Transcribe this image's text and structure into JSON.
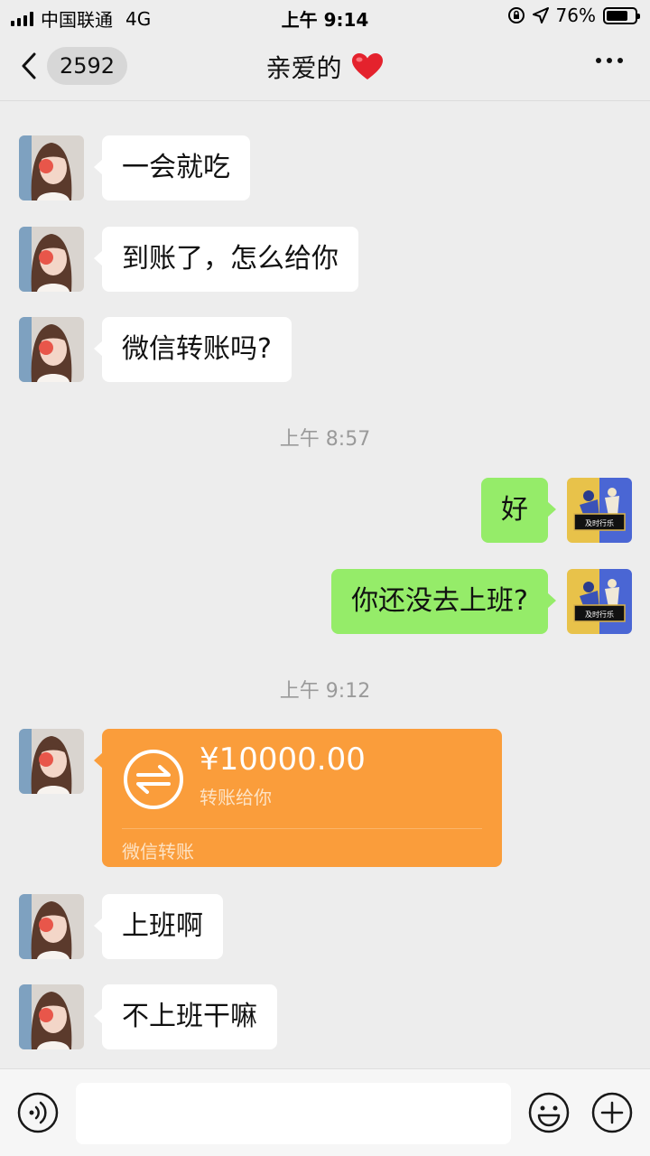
{
  "status_bar": {
    "carrier": "中国联通",
    "network": "4G",
    "time": "上午 9:14",
    "battery": "76%",
    "battery_level": 0.76
  },
  "nav": {
    "unread_count": "2592",
    "title": "亲爱的",
    "title_icon": "red-heart-emoji"
  },
  "colors": {
    "background": "#ededed",
    "incoming_bubble": "#ffffff",
    "outgoing_bubble": "#95ec69",
    "transfer_card": "#fa9d3b",
    "timestamp": "#9a9a9a"
  },
  "messages": [
    {
      "direction": "in",
      "text": "一会就吃"
    },
    {
      "direction": "in",
      "text": "到账了，怎么给你"
    },
    {
      "direction": "in",
      "text": "微信转账吗?"
    },
    {
      "timestamp": "上午 8:57"
    },
    {
      "direction": "out",
      "text": "好"
    },
    {
      "direction": "out",
      "text": "你还没去上班?"
    },
    {
      "timestamp": "上午 9:12"
    },
    {
      "direction": "in",
      "type": "transfer",
      "amount": "¥10000.00",
      "note": "转账给你",
      "footer": "微信转账"
    },
    {
      "direction": "in",
      "text": "上班啊"
    },
    {
      "direction": "in",
      "text": "不上班干嘛"
    }
  ],
  "self_avatar_caption": "及时行乐",
  "input_bar": {
    "placeholder": "",
    "left_icon": "voice-icon",
    "right_icons": [
      "emoji-icon",
      "plus-icon"
    ]
  }
}
